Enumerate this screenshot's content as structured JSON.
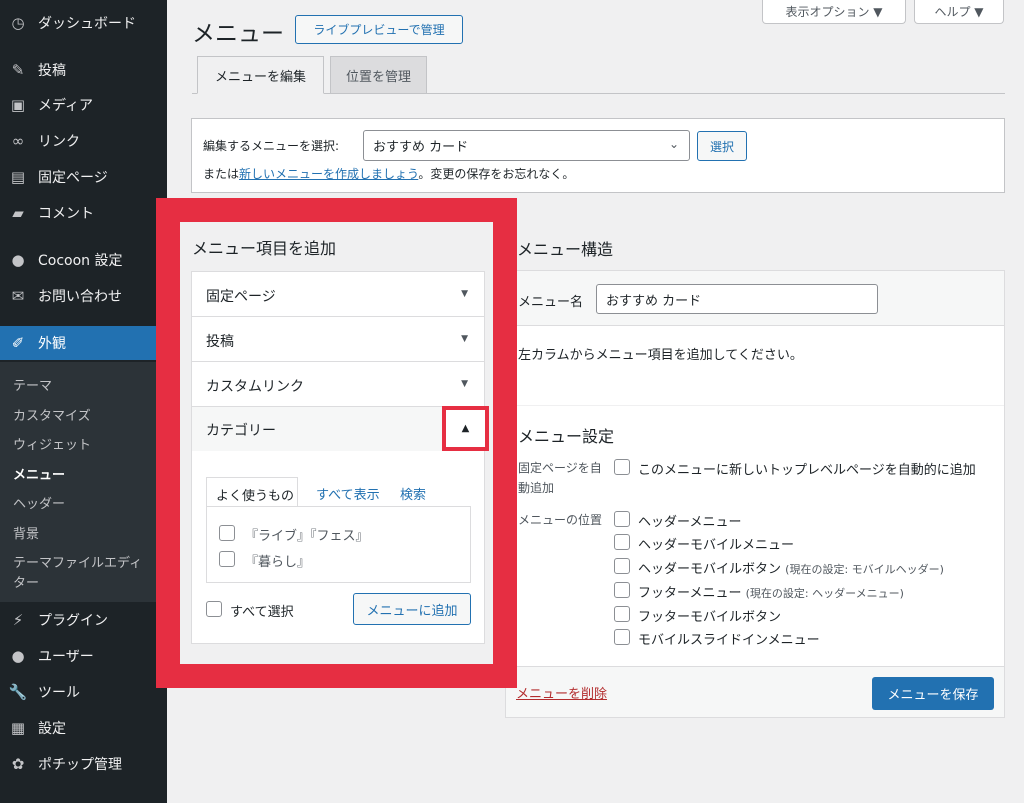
{
  "sidebar": {
    "items": [
      {
        "label": "ダッシュボード",
        "icon": "dashboard-icon",
        "glyph": "◷"
      },
      {
        "label": "投稿",
        "icon": "pin-icon",
        "glyph": "✎"
      },
      {
        "label": "メディア",
        "icon": "media-icon",
        "glyph": "▣"
      },
      {
        "label": "リンク",
        "icon": "link-icon",
        "glyph": "∞"
      },
      {
        "label": "固定ページ",
        "icon": "page-icon",
        "glyph": "▤"
      },
      {
        "label": "コメント",
        "icon": "comment-icon",
        "glyph": "▰"
      },
      {
        "label": "Cocoon 設定",
        "icon": "circle-icon",
        "glyph": "●"
      },
      {
        "label": "お問い合わせ",
        "icon": "mail-icon",
        "glyph": "✉"
      },
      {
        "label": "外観",
        "icon": "appearance-icon",
        "glyph": "✐"
      },
      {
        "label": "プラグイン",
        "icon": "plugin-icon",
        "glyph": "⚡"
      },
      {
        "label": "ユーザー",
        "icon": "user-icon",
        "glyph": "●"
      },
      {
        "label": "ツール",
        "icon": "wrench-icon",
        "glyph": "🔧"
      },
      {
        "label": "設定",
        "icon": "settings-icon",
        "glyph": "▦"
      },
      {
        "label": "ポチップ管理",
        "icon": "paw-icon",
        "glyph": "✿"
      }
    ],
    "submenu": [
      "テーマ",
      "カスタマイズ",
      "ウィジェット",
      "メニュー",
      "ヘッダー",
      "背景",
      "テーマファイルエディ",
      "ター"
    ]
  },
  "header": {
    "title": "メニュー",
    "live_preview": "ライブプレビューで管理",
    "screen_options": "表示オプション ▼",
    "help": "ヘルプ ▼"
  },
  "tabs": {
    "edit": "メニューを編集",
    "locations": "位置を管理"
  },
  "select_menu": {
    "label": "編集するメニューを選択:",
    "value": "おすすめ カード",
    "select_button": "選択",
    "or_text": "または",
    "create_link": "新しいメニューを作成しましょう",
    "reminder": "。変更の保存をお忘れなく。"
  },
  "add_items": {
    "heading": "メニュー項目を追加",
    "sections": [
      "固定ページ",
      "投稿",
      "カスタムリンク",
      "カテゴリー"
    ],
    "inner_tabs": [
      "よく使うもの",
      "すべて表示",
      "検索"
    ],
    "categories": [
      "『ライブ』『フェス』",
      "『暮らし』"
    ],
    "select_all": "すべて選択",
    "add_button": "メニューに追加"
  },
  "structure": {
    "heading": "メニュー構造",
    "name_label": "メニュー名",
    "name_value": "おすすめ カード",
    "hint": "左カラムからメニュー項目を追加してください。",
    "settings_heading": "メニュー設定",
    "auto_add_label_1": "固定ページを自",
    "auto_add_label_2": "動追加",
    "auto_add_option": "このメニューに新しいトップレベルページを自動的に追加",
    "location_label": "メニューの位置",
    "locations": [
      {
        "name": "ヘッダーメニュー",
        "note": ""
      },
      {
        "name": "ヘッダーモバイルメニュー",
        "note": ""
      },
      {
        "name": "ヘッダーモバイルボタン",
        "note": "(現在の設定: モバイルヘッダー)"
      },
      {
        "name": "フッターメニュー",
        "note": "(現在の設定: ヘッダーメニュー)"
      },
      {
        "name": "フッターモバイルボタン",
        "note": ""
      },
      {
        "name": "モバイルスライドインメニュー",
        "note": ""
      }
    ],
    "delete_link": "メニューを削除",
    "save_button": "メニューを保存"
  }
}
